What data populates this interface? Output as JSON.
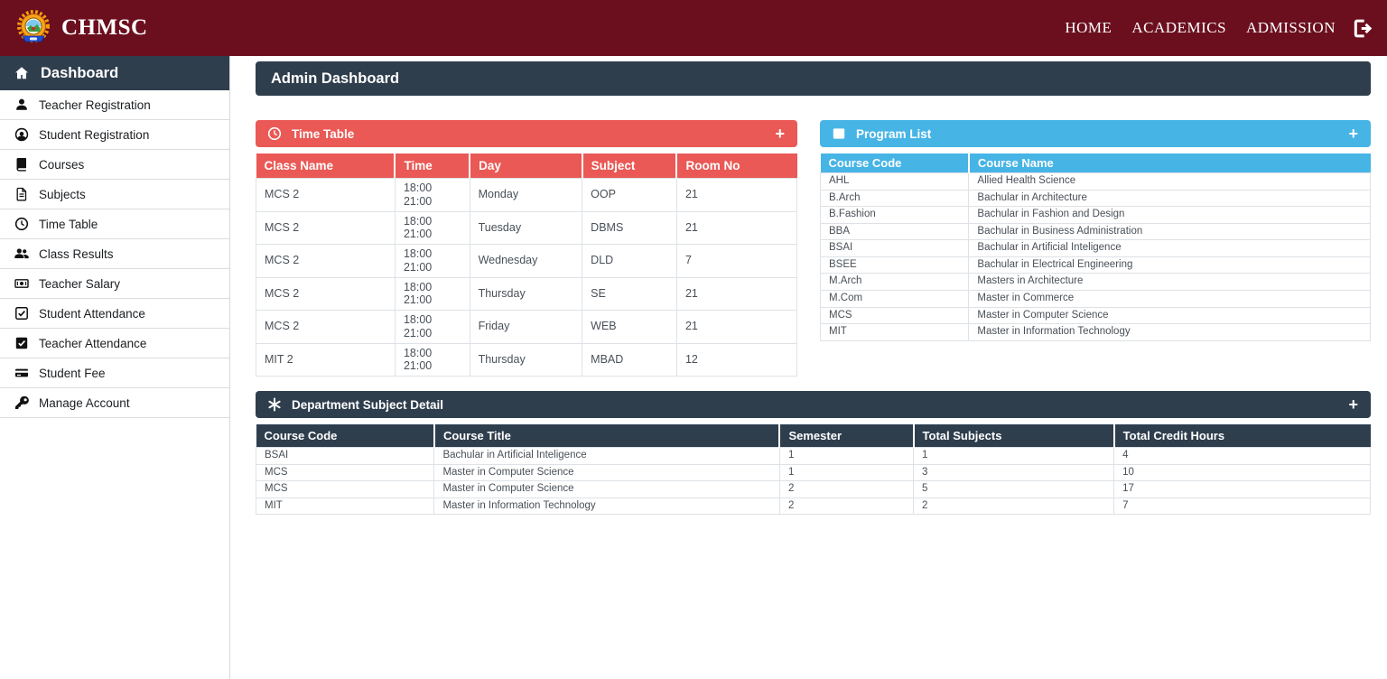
{
  "brand": {
    "name": "CHMSC",
    "logo_icon": "chmsc-emblem-logo"
  },
  "top_nav": {
    "items": [
      "HOME",
      "ACADEMICS",
      "ADMISSION"
    ],
    "logout_icon": "sign-out-icon"
  },
  "sidebar": {
    "header": {
      "icon": "home-icon",
      "label": "Dashboard"
    },
    "items": [
      {
        "icon": "user-icon",
        "label": "Teacher Registration"
      },
      {
        "icon": "user-circle-icon",
        "label": "Student Registration"
      },
      {
        "icon": "book-icon",
        "label": "Courses"
      },
      {
        "icon": "file-icon",
        "label": "Subjects"
      },
      {
        "icon": "clock-icon",
        "label": "Time Table"
      },
      {
        "icon": "users-icon",
        "label": "Class Results"
      },
      {
        "icon": "money-bill-icon",
        "label": "Teacher Salary"
      },
      {
        "icon": "check-square-icon",
        "label": "Student Attendance"
      },
      {
        "icon": "check-square-solid-icon",
        "label": "Teacher Attendance"
      },
      {
        "icon": "credit-card-icon",
        "label": "Student Fee"
      },
      {
        "icon": "key-icon",
        "label": "Manage Account"
      }
    ]
  },
  "page": {
    "title": "Admin Dashboard"
  },
  "cards": {
    "time_table": {
      "title": "Time Table",
      "icon": "clock-icon",
      "add_label": "+",
      "columns": [
        "Class Name",
        "Time",
        "Day",
        "Subject",
        "Room No"
      ],
      "rows": [
        [
          "MCS 2",
          "18:00\n21:00",
          "Monday",
          "OOP",
          "21"
        ],
        [
          "MCS 2",
          "18:00\n21:00",
          "Tuesday",
          "DBMS",
          "21"
        ],
        [
          "MCS 2",
          "18:00\n21:00",
          "Wednesday",
          "DLD",
          "7"
        ],
        [
          "MCS 2",
          "18:00\n21:00",
          "Thursday",
          "SE",
          "21"
        ],
        [
          "MCS 2",
          "18:00\n21:00",
          "Friday",
          "WEB",
          "21"
        ],
        [
          "MIT 2",
          "18:00\n21:00",
          "Thursday",
          "MBAD",
          "12"
        ]
      ]
    },
    "program_list": {
      "title": "Program List",
      "icon": "list-icon",
      "add_label": "+",
      "columns": [
        "Course Code",
        "Course Name"
      ],
      "rows": [
        [
          "AHL",
          "Allied Health Science"
        ],
        [
          "B.Arch",
          "Bachular in Architecture"
        ],
        [
          "B.Fashion",
          "Bachular in Fashion and Design"
        ],
        [
          "BBA",
          "Bachular in Business Administration"
        ],
        [
          "BSAI",
          "Bachular in Artificial Inteligence"
        ],
        [
          "BSEE",
          "Bachular in Electrical Engineering"
        ],
        [
          "M.Arch",
          "Masters in Architecture"
        ],
        [
          "M.Com",
          "Master in Commerce"
        ],
        [
          "MCS",
          "Master in Computer Science"
        ],
        [
          "MIT",
          "Master in Information Technology"
        ]
      ]
    },
    "department_subject_detail": {
      "title": "Department Subject Detail",
      "icon": "asterisk-icon",
      "add_label": "+",
      "columns": [
        "Course Code",
        "Course Title",
        "Semester",
        "Total Subjects",
        "Total Credit Hours"
      ],
      "rows": [
        [
          "BSAI",
          "Bachular in Artificial Inteligence",
          "1",
          "1",
          "4"
        ],
        [
          "MCS",
          "Master in Computer Science",
          "1",
          "3",
          "10"
        ],
        [
          "MCS",
          "Master in Computer Science",
          "2",
          "5",
          "17"
        ],
        [
          "MIT",
          "Master in Information Technology",
          "2",
          "2",
          "7"
        ]
      ]
    }
  },
  "colors": {
    "header_bg": "#6b0f1f",
    "panel_dark": "#2f3e4d",
    "danger": "#ea5955",
    "info": "#47b4e6",
    "row_border": "#dee2e6"
  }
}
